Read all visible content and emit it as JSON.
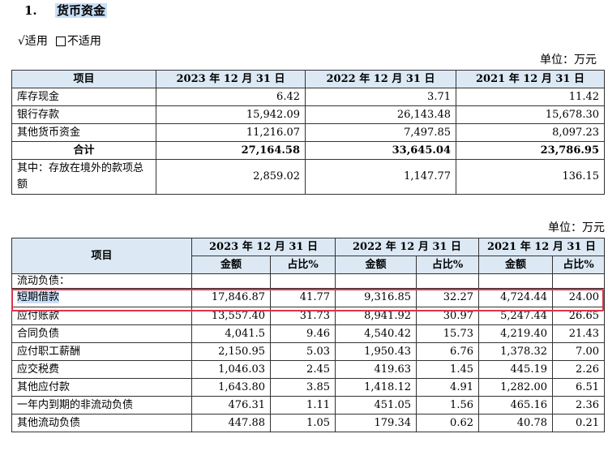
{
  "heading": {
    "number": "1.",
    "title": "货币资金"
  },
  "applicability": {
    "check": "√",
    "applicable": "适用",
    "not_applicable": "不适用"
  },
  "table1": {
    "unit": "单位：万元",
    "header": [
      "项目",
      "2023 年 12 月 31 日",
      "2022 年 12 月 31 日",
      "2021 年 12 月 31 日"
    ],
    "rows": [
      {
        "label": "库存现金",
        "values": [
          "6.42",
          "3.71",
          "11.42"
        ]
      },
      {
        "label": "银行存款",
        "values": [
          "15,942.09",
          "26,143.48",
          "15,678.30"
        ]
      },
      {
        "label": "其他货币资金",
        "values": [
          "11,216.07",
          "7,497.85",
          "8,097.23"
        ]
      }
    ],
    "total": {
      "label": "合计",
      "values": [
        "27,164.58",
        "33,645.04",
        "23,786.95"
      ]
    },
    "overseas": {
      "label": "其中：存放在境外的款项总额",
      "values": [
        "2,859.02",
        "1,147.77",
        "136.15"
      ]
    }
  },
  "table2": {
    "unit": "单位：万元",
    "item_header": "项目",
    "years": [
      "2023 年 12 月 31 日",
      "2022 年 12 月 31 日",
      "2021 年 12 月 31 日"
    ],
    "sub_headers": [
      "金额",
      "占比%"
    ],
    "category": "流动负债：",
    "rows": [
      {
        "label": "短期借款",
        "values": [
          "17,846.87",
          "41.77",
          "9,316.85",
          "32.27",
          "4,724.44",
          "24.00"
        ]
      },
      {
        "label": "应付账款",
        "values": [
          "13,557.40",
          "31.73",
          "8,941.92",
          "30.97",
          "5,247.44",
          "26.65"
        ]
      },
      {
        "label": "合同负债",
        "values": [
          "4,041.5",
          "9.46",
          "4,540.42",
          "15.73",
          "4,219.40",
          "21.43"
        ]
      },
      {
        "label": "应付职工薪酬",
        "values": [
          "2,150.95",
          "5.03",
          "1,950.43",
          "6.76",
          "1,378.32",
          "7.00"
        ]
      },
      {
        "label": "应交税费",
        "values": [
          "1,046.03",
          "2.45",
          "419.63",
          "1.45",
          "445.19",
          "2.26"
        ]
      },
      {
        "label": "其他应付款",
        "values": [
          "1,643.80",
          "3.85",
          "1,418.12",
          "4.91",
          "1,282.00",
          "6.51"
        ]
      },
      {
        "label": "一年内到期的非流动负债",
        "values": [
          "476.31",
          "1.11",
          "451.05",
          "1.56",
          "465.16",
          "2.36"
        ]
      },
      {
        "label": "其他流动负债",
        "values": [
          "447.88",
          "1.05",
          "179.34",
          "0.62",
          "40.78",
          "0.21"
        ]
      }
    ]
  },
  "highlight_color": "#e0334b"
}
